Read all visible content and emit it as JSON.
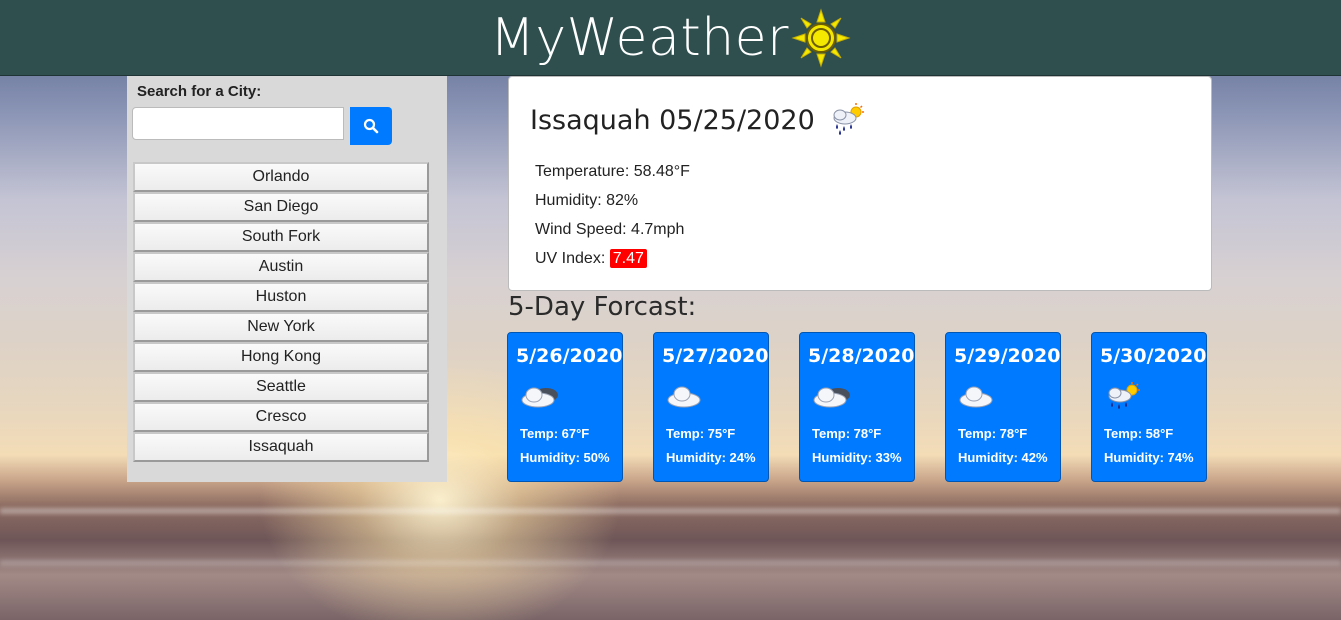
{
  "header": {
    "title": "MyWeather",
    "logo_icon": "sun-icon"
  },
  "sidebar": {
    "search_label": "Search for a City:",
    "search_value": "",
    "search_button_icon": "search-icon",
    "cities": [
      "Orlando",
      "San Diego",
      "South Fork",
      "Austin",
      "Huston",
      "New York",
      "Hong Kong",
      "Seattle",
      "Cresco",
      "Issaquah"
    ]
  },
  "current": {
    "title": "Issaquah 05/25/2020",
    "icon": "rain-sun-icon",
    "temperature": "Temperature: 58.48°F",
    "humidity": "Humidity: 82%",
    "wind": "Wind Speed: 4.7mph",
    "uv_label": "UV Index:",
    "uv_value": "7.47",
    "uv_color": "#ff0000"
  },
  "forecast": {
    "title": "5-Day Forcast:",
    "accent": "#007bff",
    "days": [
      {
        "date": "5/26/2020",
        "icon": "cloud-dark-icon",
        "temp": "Temp: 67°F",
        "humidity": "Humidity: 50%"
      },
      {
        "date": "5/27/2020",
        "icon": "cloud-icon",
        "temp": "Temp: 75°F",
        "humidity": "Humidity: 24%"
      },
      {
        "date": "5/28/2020",
        "icon": "cloud-dark-icon",
        "temp": "Temp: 78°F",
        "humidity": "Humidity: 33%"
      },
      {
        "date": "5/29/2020",
        "icon": "cloud-icon",
        "temp": "Temp: 78°F",
        "humidity": "Humidity: 42%"
      },
      {
        "date": "5/30/2020",
        "icon": "rain-sun-icon",
        "temp": "Temp: 58°F",
        "humidity": "Humidity: 74%"
      }
    ]
  }
}
